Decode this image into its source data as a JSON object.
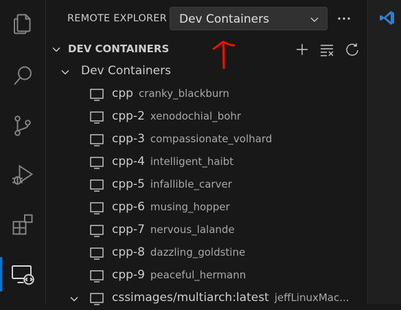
{
  "activity_bar": {
    "items": [
      {
        "name": "explorer-icon"
      },
      {
        "name": "search-icon"
      },
      {
        "name": "source-control-icon"
      },
      {
        "name": "run-debug-icon"
      },
      {
        "name": "extensions-icon"
      },
      {
        "name": "remote-explorer-icon"
      }
    ],
    "active_item": "remote-explorer-icon"
  },
  "sidebar": {
    "title": "REMOTE EXPLORER",
    "selector": {
      "value": "Dev Containers"
    },
    "section": {
      "title": "DEV CONTAINERS",
      "actions": [
        "add-icon",
        "clear-all-icon",
        "refresh-icon"
      ]
    },
    "group": {
      "label": "Dev Containers"
    },
    "containers": [
      {
        "name": "cpp",
        "description": "cranky_blackburn"
      },
      {
        "name": "cpp-2",
        "description": "xenodochial_bohr"
      },
      {
        "name": "cpp-3",
        "description": "compassionate_volhard"
      },
      {
        "name": "cpp-4",
        "description": "intelligent_haibt"
      },
      {
        "name": "cpp-5",
        "description": "infallible_carver"
      },
      {
        "name": "cpp-6",
        "description": "musing_hopper"
      },
      {
        "name": "cpp-7",
        "description": "nervous_lalande"
      },
      {
        "name": "cpp-8",
        "description": "dazzling_goldstine"
      },
      {
        "name": "cpp-9",
        "description": "peaceful_hermann"
      }
    ],
    "last_item": {
      "name": "cssimages/multiarch:latest",
      "description": "jeffLinuxMac..."
    }
  },
  "colors": {
    "background": "#181818",
    "accent": "#0078d4",
    "annotation": "#e51400",
    "text": "#cccccc"
  }
}
